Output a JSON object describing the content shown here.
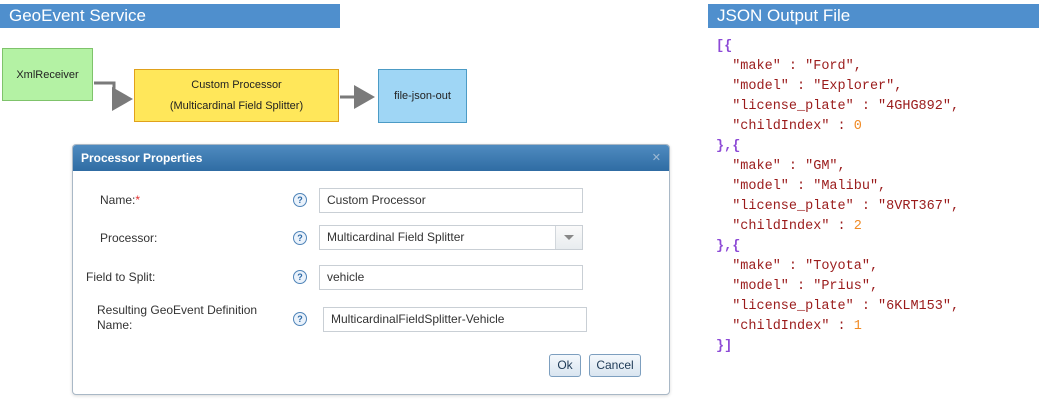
{
  "headers": {
    "left": "GeoEvent Service",
    "right": "JSON Output File"
  },
  "flow": {
    "receiver": "XmlReceiver",
    "processor_line1": "Custom Processor",
    "processor_line2": "(Multicardinal Field Splitter)",
    "output": "file-json-out"
  },
  "dialog": {
    "title": "Processor Properties",
    "close_glyph": "✕",
    "help_glyph": "?",
    "required_mark": "*",
    "fields": [
      {
        "label": "Name:",
        "value": "Custom Processor",
        "required": true
      },
      {
        "label": "Processor:",
        "value": "Multicardinal Field Splitter"
      },
      {
        "label": "Field to Split:",
        "value": "vehicle"
      },
      {
        "label": "Resulting GeoEvent Definition Name:",
        "value": "MulticardinalFieldSplitter-Vehicle"
      }
    ],
    "ok_label": "Ok",
    "cancel_label": "Cancel"
  },
  "json_output": {
    "records": [
      {
        "make": "Ford",
        "model": "Explorer",
        "license_plate": "4GHG892",
        "childIndex": 0
      },
      {
        "make": "GM",
        "model": "Malibu",
        "license_plate": "8VRT367",
        "childIndex": 2
      },
      {
        "make": "Toyota",
        "model": "Prius",
        "license_plate": "6KLM153",
        "childIndex": 1
      }
    ]
  },
  "colors": {
    "header_bg": "#4f8fcd",
    "receiver_bg": "#b4f2a4",
    "processor_bg": "#ffe75a",
    "output_bg": "#9fd6f5",
    "json_key": "#9a1b1b",
    "json_bracket": "#8d4ad6",
    "json_number": "#f08a24"
  }
}
